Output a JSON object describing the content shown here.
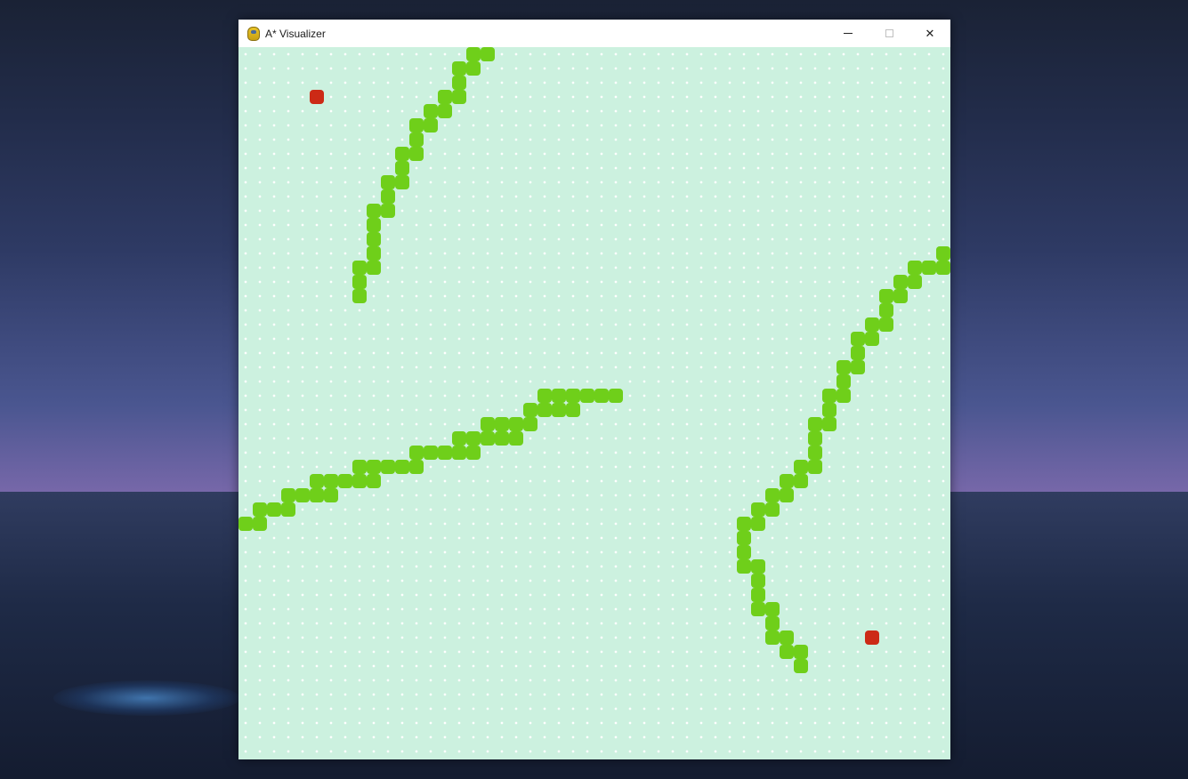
{
  "window": {
    "title": "A* Visualizer",
    "app_icon": "python-snake-icon",
    "controls": [
      "minimize-icon",
      "maximize-icon",
      "close-icon"
    ],
    "close_label": "✕"
  },
  "grid": {
    "columns": 50,
    "rows": 50,
    "background_color": "#ccf1df",
    "dot_color": "#ffffff",
    "wall_color": "#6fcf1a",
    "endpoint_color": "#cc2a16",
    "endpoints": [
      {
        "name": "start",
        "col": 5,
        "row": 3
      },
      {
        "name": "end",
        "col": 44,
        "row": 41
      }
    ],
    "walls": [
      [
        16,
        0
      ],
      [
        17,
        0
      ],
      [
        15,
        1
      ],
      [
        16,
        1
      ],
      [
        15,
        2
      ],
      [
        14,
        3
      ],
      [
        15,
        3
      ],
      [
        13,
        4
      ],
      [
        14,
        4
      ],
      [
        12,
        5
      ],
      [
        13,
        5
      ],
      [
        12,
        6
      ],
      [
        11,
        7
      ],
      [
        12,
        7
      ],
      [
        11,
        8
      ],
      [
        10,
        9
      ],
      [
        11,
        9
      ],
      [
        10,
        10
      ],
      [
        9,
        11
      ],
      [
        10,
        11
      ],
      [
        9,
        12
      ],
      [
        9,
        13
      ],
      [
        9,
        14
      ],
      [
        8,
        15
      ],
      [
        9,
        15
      ],
      [
        8,
        16
      ],
      [
        8,
        17
      ],
      [
        49,
        14
      ],
      [
        47,
        15
      ],
      [
        48,
        15
      ],
      [
        49,
        15
      ],
      [
        46,
        16
      ],
      [
        47,
        16
      ],
      [
        45,
        17
      ],
      [
        46,
        17
      ],
      [
        45,
        18
      ],
      [
        44,
        19
      ],
      [
        45,
        19
      ],
      [
        43,
        20
      ],
      [
        44,
        20
      ],
      [
        43,
        21
      ],
      [
        42,
        22
      ],
      [
        43,
        22
      ],
      [
        42,
        23
      ],
      [
        41,
        24
      ],
      [
        42,
        24
      ],
      [
        41,
        25
      ],
      [
        40,
        26
      ],
      [
        41,
        26
      ],
      [
        40,
        27
      ],
      [
        40,
        28
      ],
      [
        39,
        29
      ],
      [
        40,
        29
      ],
      [
        38,
        30
      ],
      [
        39,
        30
      ],
      [
        37,
        31
      ],
      [
        38,
        31
      ],
      [
        36,
        32
      ],
      [
        37,
        32
      ],
      [
        35,
        33
      ],
      [
        36,
        33
      ],
      [
        35,
        34
      ],
      [
        35,
        35
      ],
      [
        35,
        36
      ],
      [
        36,
        36
      ],
      [
        36,
        37
      ],
      [
        36,
        38
      ],
      [
        36,
        39
      ],
      [
        37,
        39
      ],
      [
        37,
        40
      ],
      [
        37,
        41
      ],
      [
        38,
        41
      ],
      [
        38,
        42
      ],
      [
        39,
        42
      ],
      [
        39,
        43
      ],
      [
        21,
        24
      ],
      [
        22,
        24
      ],
      [
        23,
        24
      ],
      [
        24,
        24
      ],
      [
        25,
        24
      ],
      [
        26,
        24
      ],
      [
        20,
        25
      ],
      [
        21,
        25
      ],
      [
        22,
        25
      ],
      [
        23,
        25
      ],
      [
        17,
        26
      ],
      [
        18,
        26
      ],
      [
        19,
        26
      ],
      [
        20,
        26
      ],
      [
        15,
        27
      ],
      [
        16,
        27
      ],
      [
        17,
        27
      ],
      [
        18,
        27
      ],
      [
        19,
        27
      ],
      [
        12,
        28
      ],
      [
        13,
        28
      ],
      [
        14,
        28
      ],
      [
        15,
        28
      ],
      [
        16,
        28
      ],
      [
        8,
        29
      ],
      [
        9,
        29
      ],
      [
        10,
        29
      ],
      [
        11,
        29
      ],
      [
        12,
        29
      ],
      [
        5,
        30
      ],
      [
        6,
        30
      ],
      [
        7,
        30
      ],
      [
        8,
        30
      ],
      [
        9,
        30
      ],
      [
        3,
        31
      ],
      [
        4,
        31
      ],
      [
        5,
        31
      ],
      [
        6,
        31
      ],
      [
        1,
        32
      ],
      [
        2,
        32
      ],
      [
        3,
        32
      ],
      [
        0,
        33
      ],
      [
        1,
        33
      ]
    ]
  }
}
